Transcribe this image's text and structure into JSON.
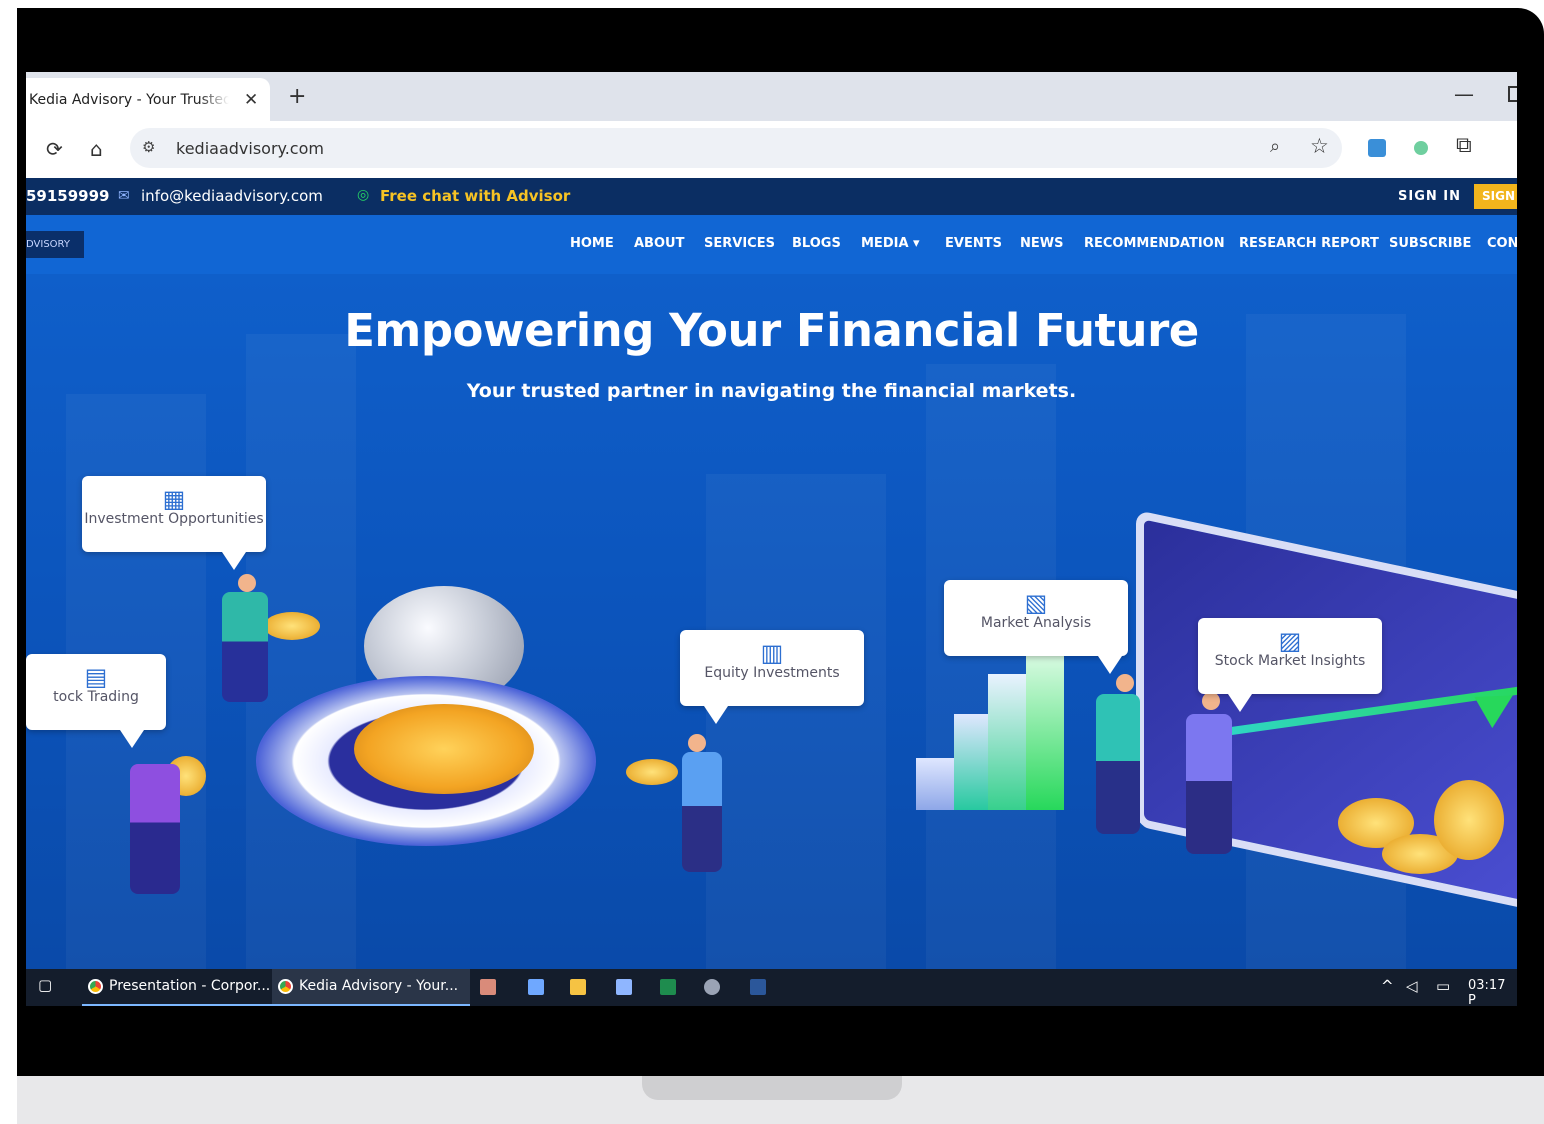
{
  "browser": {
    "tab_title": "Kedia Advisory - Your Trusted S",
    "tab_close": "✕",
    "new_tab": "+",
    "minimize": "—",
    "url": "kediaadvisory.com"
  },
  "topbar": {
    "phone": "59159999",
    "email": "info@kediaadvisory.com",
    "chat": "Free chat with Advisor",
    "sign_in": "SIGN IN",
    "sign_up": "SIGN"
  },
  "nav": {
    "logo": "DVISORY",
    "items": [
      "HOME",
      "ABOUT",
      "SERVICES",
      "BLOGS",
      "MEDIA ▾",
      "EVENTS",
      "NEWS",
      "RECOMMENDATION",
      "RESEARCH REPORT",
      "SUBSCRIBE",
      "CON"
    ]
  },
  "hero": {
    "title": "Empowering Your Financial Future",
    "subtitle": "Your trusted partner in navigating the financial markets."
  },
  "bubbles": {
    "investment": "Investment Opportunities",
    "trading": "tock Trading",
    "equity": "Equity Investments",
    "market": "Market Analysis",
    "insights": "Stock Market Insights"
  },
  "taskbar": {
    "task1": "Presentation - Corpor...",
    "task2": "Kedia Advisory - Your...",
    "time": "03:17 P"
  },
  "colors": {
    "topbar_bg": "#0b2e63",
    "nav_bg": "#1166d4",
    "accent_yellow": "#f7c324",
    "signup_bg": "#f2b51c"
  },
  "icons": {
    "reload": "⟳",
    "home": "⌂",
    "site_settings": "⚙",
    "zoom": "🔍",
    "star": "☆",
    "mail": "✉",
    "whatsapp": "◎",
    "up_arrow": "^",
    "speaker": "🔊",
    "network": "▭"
  }
}
